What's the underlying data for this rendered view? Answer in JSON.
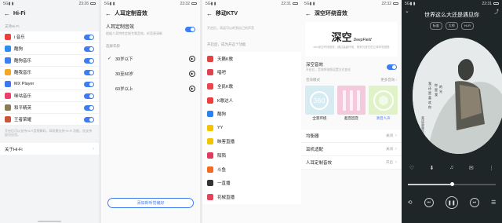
{
  "colors": {
    "accent": "#3c7df5",
    "dark_bg": "#1f2628"
  },
  "panel1": {
    "status_time": "23:26",
    "title": "Hi-Fi",
    "section": "支持Hi-Fi",
    "apps": [
      {
        "label": "i 音乐",
        "color": "#e8423a"
      },
      {
        "label": "酷狗",
        "color": "#2d8cf0"
      },
      {
        "label": "酷狗音乐",
        "color": "#3d7ef0"
      },
      {
        "label": "酷我音乐",
        "color": "#f5a623"
      },
      {
        "label": "MX Player",
        "color": "#3a79f0"
      },
      {
        "label": "咪咕音乐",
        "color": "#e6426b"
      },
      {
        "label": "和平精英",
        "color": "#8b7a52"
      },
      {
        "label": "王者荣耀",
        "color": "#c9553a"
      }
    ],
    "note": "开启后可以支持Hi-Fi音频解码，耳机需支持 Hi-Fi 功能，仅支持部分应用。",
    "about": "关于Hi-Fi"
  },
  "panel2": {
    "status_time": "23:32",
    "title": "人耳定制音效",
    "toggle_label": "人耳定制音效",
    "toggle_desc": "根据人耳特性定制专属音效，听音更清晰",
    "section": "选择年龄",
    "ages": [
      "30岁以下",
      "30至60岁",
      "60岁以上"
    ],
    "add_button": "添加新听觉偏好"
  },
  "panel3": {
    "status_time": "22:31",
    "title": "移动KTV",
    "note": "开启后，耳返可以听到自己的声音",
    "section": "开启后，成为开这个功能",
    "apps": [
      {
        "label": "天籁K歌",
        "color": "#e54343"
      },
      {
        "label": "唱吧",
        "color": "#e0424f"
      },
      {
        "label": "全民K歌",
        "color": "#f0424a"
      },
      {
        "label": "K歌达人",
        "color": "#ef3b3b"
      },
      {
        "label": "酷狗",
        "color": "#2a80f0"
      },
      {
        "label": "YY",
        "color": "#f5c400"
      },
      {
        "label": "映客直播",
        "color": "#f3c400"
      },
      {
        "label": "陌陌",
        "color": "#e23a5c"
      },
      {
        "label": "斗鱼",
        "color": "#f56a1e"
      },
      {
        "label": "一直播",
        "color": "#333333"
      },
      {
        "label": "花椒直播",
        "color": "#e8425a"
      }
    ]
  },
  "panel4": {
    "status_time": "22:32",
    "title": "深空环绕音效",
    "brand": "深空",
    "brand_sub": "DeepField",
    "desc": "vivo深空环绕音效，通过高级环绕，带来沉浸式的立体听觉感受",
    "toggle_label": "深空音效",
    "toggle_desc": "开启后，音效将按照设置方式变化",
    "section": "音效模式",
    "section_more": "更多音效",
    "cards": [
      {
        "label": "全景环绕",
        "bg": "#d6ecf2"
      },
      {
        "label": "超音回音",
        "bg": "#f4c9dc"
      },
      {
        "label": "清音人声",
        "bg": "#dff2c8"
      }
    ],
    "rows": [
      {
        "label": "均衡器",
        "value": "关闭"
      },
      {
        "label": "耳机适配",
        "value": "关闭"
      },
      {
        "label": "人耳定制音效",
        "value": "开启"
      }
    ]
  },
  "panel5": {
    "status_time": "22:31",
    "song_title": "世界这么大还是遇见你",
    "tags": [
      "标准",
      "大师",
      "Hi-Fi"
    ],
    "disc_text": "我还是喜欢你"
  }
}
